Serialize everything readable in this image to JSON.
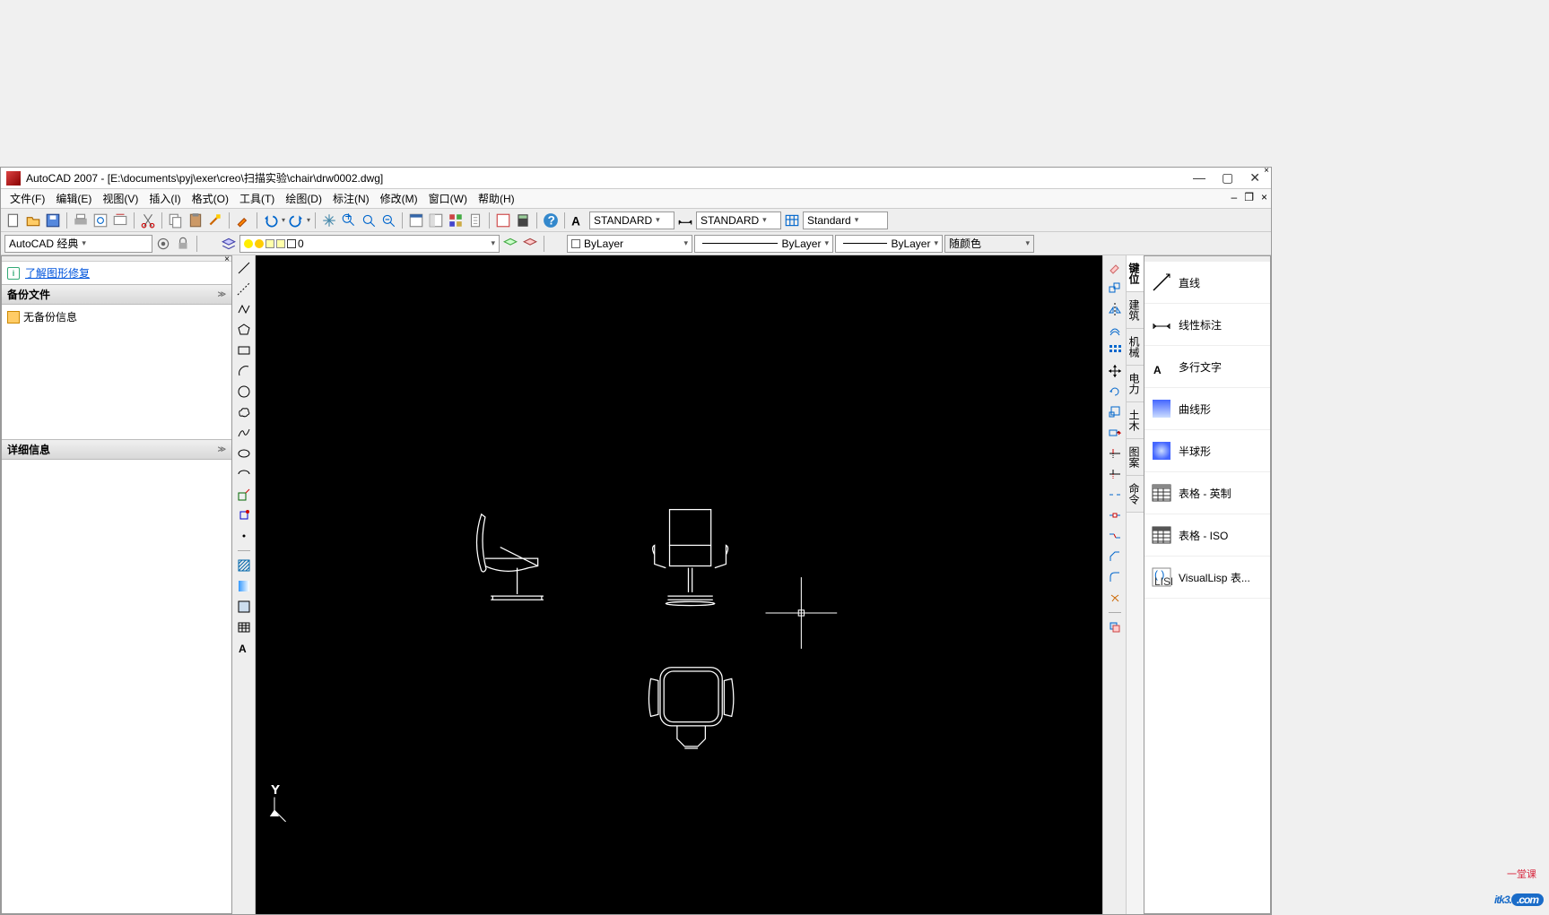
{
  "title_bar": {
    "app_name": "AutoCAD 2007",
    "file_path": "[E:\\documents\\pyj\\exer\\creo\\扫描实验\\chair\\drw0002.dwg]"
  },
  "menu": {
    "items": [
      {
        "label": "文件(F)"
      },
      {
        "label": "编辑(E)"
      },
      {
        "label": "视图(V)"
      },
      {
        "label": "插入(I)"
      },
      {
        "label": "格式(O)"
      },
      {
        "label": "工具(T)"
      },
      {
        "label": "绘图(D)"
      },
      {
        "label": "标注(N)"
      },
      {
        "label": "修改(M)"
      },
      {
        "label": "窗口(W)"
      },
      {
        "label": "帮助(H)"
      }
    ]
  },
  "toolbars": {
    "workspace": "AutoCAD 经典",
    "text_style": "STANDARD",
    "dim_style": "STANDARD",
    "table_style": "Standard",
    "layer_name": "0",
    "color": "ByLayer",
    "linetype": "ByLayer",
    "lineweight": "ByLayer",
    "plot_style": "随颜色"
  },
  "left_panel": {
    "info_link": "了解图形修复",
    "backup_header": "备份文件",
    "backup_item": "无备份信息",
    "detail_header": "详细信息"
  },
  "vtabs": [
    "键位",
    "建筑",
    "机械",
    "电力",
    "土木",
    "图案",
    "命令"
  ],
  "right_panel": {
    "items": [
      {
        "label": "直线"
      },
      {
        "label": "线性标注"
      },
      {
        "label": "多行文字"
      },
      {
        "label": "曲线形"
      },
      {
        "label": "半球形"
      },
      {
        "label": "表格 - 英制"
      },
      {
        "label": "表格 - ISO"
      },
      {
        "label": "VisualLisp 表..."
      }
    ]
  },
  "watermark": {
    "text": "itk3",
    "suffix": ".com",
    "sub": "一堂课"
  }
}
